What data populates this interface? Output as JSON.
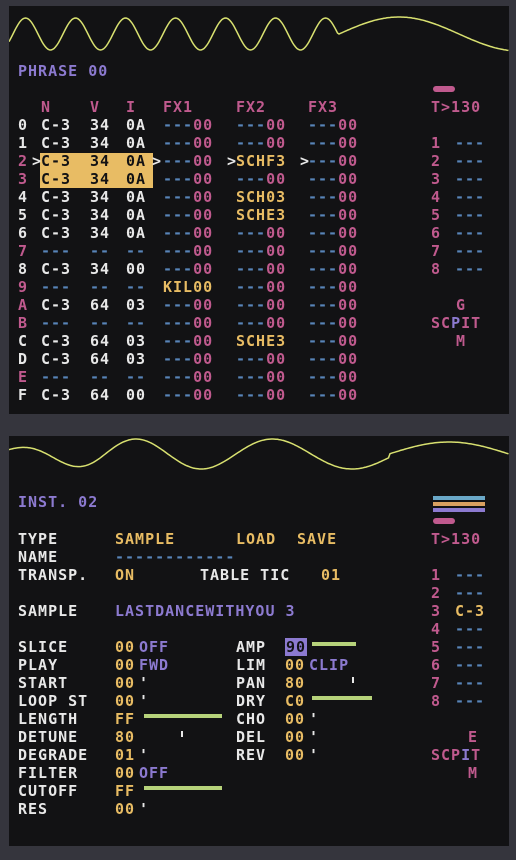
{
  "colors": {
    "background": "#121214",
    "frame": "#35353d",
    "white": "#e8e8e8",
    "orange": "#e8bc64",
    "pink": "#c05a8e",
    "blue": "#5884b8",
    "purple": "#8c7ad0",
    "wave": "#d8e070",
    "bar": "#b6d27a"
  },
  "phrase": {
    "title": "PHRASE 00",
    "headers": {
      "n": "N",
      "v": "V",
      "i": "I",
      "fx1": "FX1",
      "fx2": "FX2",
      "fx3": "FX3"
    },
    "rows": [
      {
        "idx": "0",
        "note": "C-3",
        "vel": "34",
        "inst": "0A",
        "fx1": "---00",
        "fx2": "---00",
        "fx3": "---00"
      },
      {
        "idx": "1",
        "note": "C-3",
        "vel": "34",
        "inst": "0A",
        "fx1": "---00",
        "fx2": "---00",
        "fx3": "---00"
      },
      {
        "idx": "2",
        "note": "C-3",
        "vel": "34",
        "inst": "0A",
        "fx1": "---00",
        "fx2": "SCHF3",
        "fx3": "---00"
      },
      {
        "idx": "3",
        "note": "C-3",
        "vel": "34",
        "inst": "0A",
        "fx1": "---00",
        "fx2": "---00",
        "fx3": "---00"
      },
      {
        "idx": "4",
        "note": "C-3",
        "vel": "34",
        "inst": "0A",
        "fx1": "---00",
        "fx2": "SCH03",
        "fx3": "---00"
      },
      {
        "idx": "5",
        "note": "C-3",
        "vel": "34",
        "inst": "0A",
        "fx1": "---00",
        "fx2": "SCHE3",
        "fx3": "---00"
      },
      {
        "idx": "6",
        "note": "C-3",
        "vel": "34",
        "inst": "0A",
        "fx1": "---00",
        "fx2": "---00",
        "fx3": "---00"
      },
      {
        "idx": "7",
        "note": "---",
        "vel": "--",
        "inst": "--",
        "fx1": "---00",
        "fx2": "---00",
        "fx3": "---00"
      },
      {
        "idx": "8",
        "note": "C-3",
        "vel": "34",
        "inst": "00",
        "fx1": "---00",
        "fx2": "---00",
        "fx3": "---00"
      },
      {
        "idx": "9",
        "note": "---",
        "vel": "--",
        "inst": "--",
        "fx1": "KIL00",
        "fx2": "---00",
        "fx3": "---00"
      },
      {
        "idx": "A",
        "note": "C-3",
        "vel": "64",
        "inst": "03",
        "fx1": "---00",
        "fx2": "---00",
        "fx3": "---00"
      },
      {
        "idx": "B",
        "note": "---",
        "vel": "--",
        "inst": "--",
        "fx1": "---00",
        "fx2": "---00",
        "fx3": "---00"
      },
      {
        "idx": "C",
        "note": "C-3",
        "vel": "64",
        "inst": "03",
        "fx1": "---00",
        "fx2": "SCHE3",
        "fx3": "---00"
      },
      {
        "idx": "D",
        "note": "C-3",
        "vel": "64",
        "inst": "03",
        "fx1": "---00",
        "fx2": "---00",
        "fx3": "---00"
      },
      {
        "idx": "E",
        "note": "---",
        "vel": "--",
        "inst": "--",
        "fx1": "---00",
        "fx2": "---00",
        "fx3": "---00"
      },
      {
        "idx": "F",
        "note": "C-3",
        "vel": "64",
        "inst": "00",
        "fx1": "---00",
        "fx2": "---00",
        "fx3": "---00"
      }
    ],
    "tracks": {
      "tempo": "T>130",
      "rows": [
        {
          "n": "1",
          "v": "---"
        },
        {
          "n": "2",
          "v": "---"
        },
        {
          "n": "3",
          "v": "---"
        },
        {
          "n": "4",
          "v": "---"
        },
        {
          "n": "5",
          "v": "---"
        },
        {
          "n": "6",
          "v": "---"
        },
        {
          "n": "7",
          "v": "---"
        },
        {
          "n": "8",
          "v": "---"
        }
      ]
    },
    "nav": {
      "top": "G",
      "left": "SC",
      "mid": "P",
      "right": "IT",
      "bottom": "M"
    }
  },
  "instrument": {
    "title": "INST. 02",
    "type_label": "TYPE",
    "type_value": "SAMPLE",
    "load": "LOAD",
    "save": "SAVE",
    "name_label": "NAME",
    "name_value": "------------",
    "transp_label": "TRANSP.",
    "transp_value": "ON",
    "table_label": "TABLE TIC",
    "table_value": "01",
    "sample_label": "SAMPLE",
    "sample_value": "LASTDANCEWITHYOU 3",
    "left_params": [
      {
        "label": "SLICE",
        "value": "00",
        "suffix": "OFF"
      },
      {
        "label": "PLAY",
        "value": "00",
        "suffix": "FWD"
      },
      {
        "label": "START",
        "value": "00",
        "suffix": "'"
      },
      {
        "label": "LOOP ST",
        "value": "00",
        "suffix": "'"
      },
      {
        "label": "LENGTH",
        "value": "FF",
        "suffix": ""
      },
      {
        "label": "DETUNE",
        "value": "80",
        "suffix": ""
      },
      {
        "label": "DEGRADE",
        "value": "01",
        "suffix": "'"
      },
      {
        "label": "FILTER",
        "value": "00",
        "suffix": "OFF"
      },
      {
        "label": "CUTOFF",
        "value": "FF",
        "suffix": ""
      },
      {
        "label": "RES",
        "value": "00",
        "suffix": "'"
      }
    ],
    "right_params": [
      {
        "label": "AMP",
        "value": "90",
        "suffix": ""
      },
      {
        "label": "LIM",
        "value": "00",
        "suffix": "CLIP"
      },
      {
        "label": "PAN",
        "value": "80",
        "suffix": ""
      },
      {
        "label": "DRY",
        "value": "C0",
        "suffix": ""
      },
      {
        "label": "CHO",
        "value": "00",
        "suffix": "'"
      },
      {
        "label": "DEL",
        "value": "00",
        "suffix": "'"
      },
      {
        "label": "REV",
        "value": "00",
        "suffix": "'"
      }
    ],
    "levels": {
      "length": 1.0,
      "cutoff": 1.0,
      "amp": 0.56,
      "dry": 0.75,
      "detune": 0.5,
      "pan": 0.5
    },
    "tracks": {
      "tempo": "T>130",
      "rows": [
        {
          "n": "1",
          "v": "---"
        },
        {
          "n": "2",
          "v": "---"
        },
        {
          "n": "3",
          "v": "C-3"
        },
        {
          "n": "4",
          "v": "---"
        },
        {
          "n": "5",
          "v": "---"
        },
        {
          "n": "6",
          "v": "---"
        },
        {
          "n": "7",
          "v": "---"
        },
        {
          "n": "8",
          "v": "---"
        }
      ]
    },
    "nav": {
      "top": "E",
      "left": "SCP",
      "mid": "I",
      "right": "T",
      "bottom": "M"
    }
  }
}
